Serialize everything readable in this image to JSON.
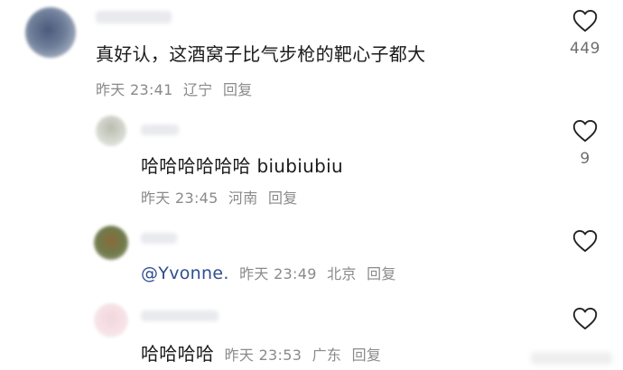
{
  "comments": [
    {
      "text": "真好认，这酒窝子比气步枪的靶心子都大",
      "time": "昨天 23:41",
      "location": "辽宁",
      "reply_label": "回复",
      "likes": "449"
    },
    {
      "text": "哈哈哈哈哈哈 biubiubiu",
      "time": "昨天 23:45",
      "location": "河南",
      "reply_label": "回复",
      "likes": "9"
    },
    {
      "mention": "@Yvonne.",
      "time": "昨天 23:49",
      "location": "北京",
      "reply_label": "回复",
      "likes": ""
    },
    {
      "text": "哈哈哈哈",
      "time": "昨天 23:53",
      "location": "广东",
      "reply_label": "回复",
      "likes": ""
    }
  ],
  "colors": {
    "text": "#1a1a1a",
    "meta": "#8a8a8a",
    "mention": "#2f4f8f"
  },
  "icons": {
    "like": "heart-outline-icon"
  }
}
